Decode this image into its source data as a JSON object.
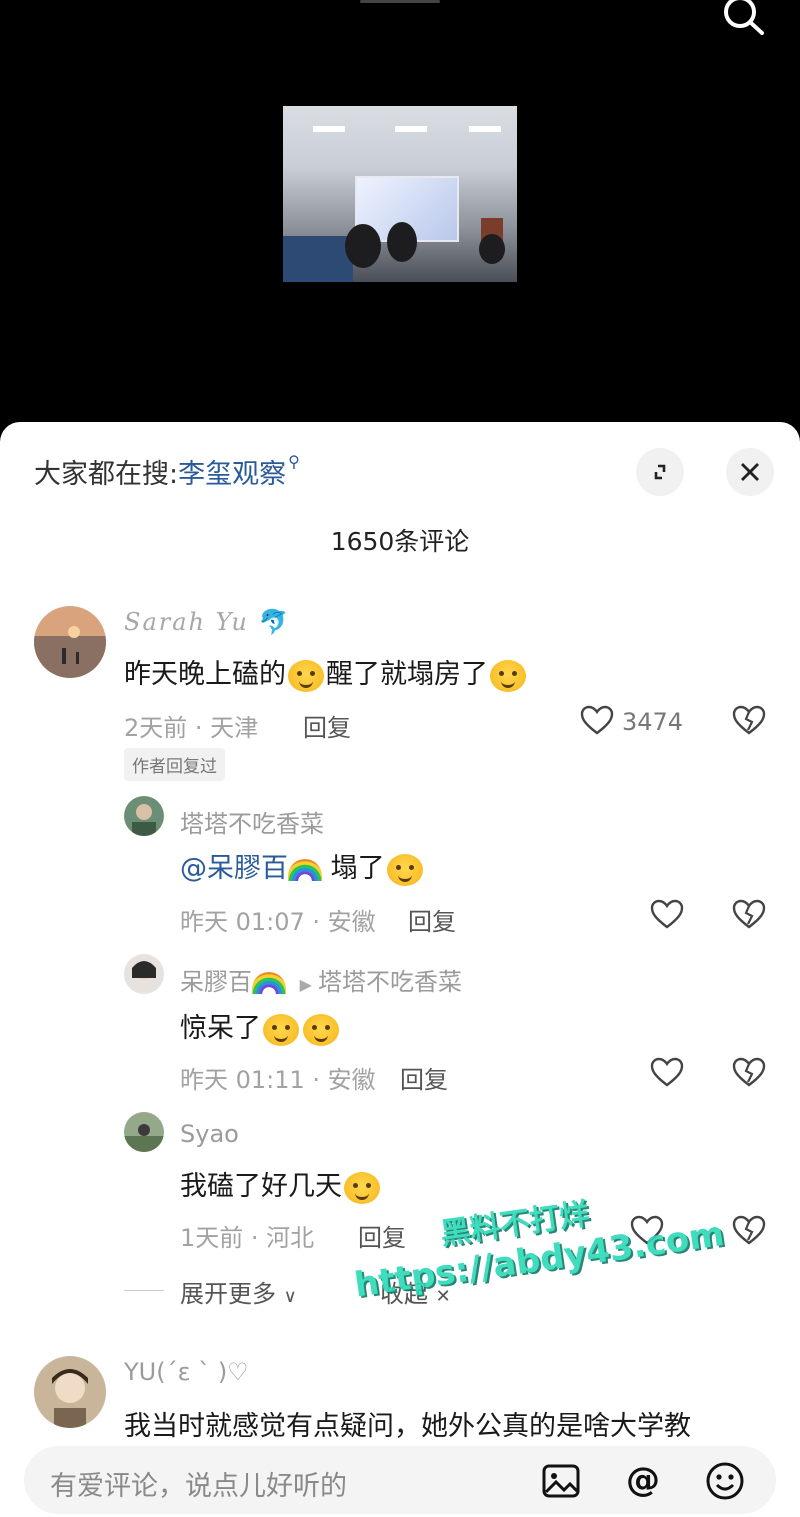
{
  "trending": {
    "prefix": "大家都在搜:",
    "keyword": "李玺观察"
  },
  "comment_count_label": "1650条评论",
  "comments": [
    {
      "user": "Sarah Yu",
      "text_a": "昨天晚上磕的",
      "text_b": "醒了就塌房了",
      "meta": "2天前 · 天津",
      "reply": "回复",
      "likes": "3474",
      "badge": "作者回复过"
    }
  ],
  "replies": [
    {
      "user": "塔塔不吃香菜",
      "mention": "@呆膠百",
      "text": "塌了",
      "meta": "昨天 01:07 · 安徽",
      "reply": "回复"
    },
    {
      "user": "呆膠百",
      "reply_to": "塔塔不吃香菜",
      "text": "惊呆了",
      "meta": "昨天 01:11 · 安徽",
      "reply": "回复"
    },
    {
      "user": "Syao",
      "text": "我磕了好几天",
      "meta": "1天前 · 河北",
      "reply": "回复"
    }
  ],
  "thread_controls": {
    "expand": "展开更多",
    "collapse": "收起"
  },
  "next_comment": {
    "user": "YU(ˊε ˋ )♡",
    "text": "我当时就感觉有点疑问，她外公真的是啥大学教"
  },
  "watermark": {
    "line1": "黑料不打烊",
    "line2": "https://abdy43.com"
  },
  "input": {
    "placeholder": "有爱评论，说点儿好听的"
  },
  "icons": [
    "search-icon",
    "expand-icon",
    "close-icon",
    "heart-icon",
    "broken-heart-icon",
    "image-icon",
    "at-icon",
    "emoji-icon"
  ]
}
